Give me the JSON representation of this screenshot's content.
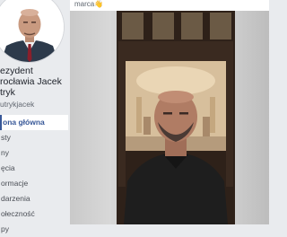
{
  "page": {
    "name_lines": [
      "ezydent",
      "rocławia Jacek",
      "tryk"
    ],
    "handle": "utrykjacek"
  },
  "nav": {
    "items": [
      {
        "label": "ona główna",
        "active": true
      },
      {
        "label": "sty",
        "active": false
      },
      {
        "label": "ny",
        "active": false
      },
      {
        "label": "ęcia",
        "active": false
      },
      {
        "label": "ormacje",
        "active": false
      },
      {
        "label": "darzenia",
        "active": false
      },
      {
        "label": "ołeczność",
        "active": false
      },
      {
        "label": "py",
        "active": false
      }
    ]
  },
  "post": {
    "date_fragment": "marca",
    "icon": "waving-hand-icon"
  },
  "colors": {
    "background": "#e9ebee",
    "link": "#385898"
  }
}
